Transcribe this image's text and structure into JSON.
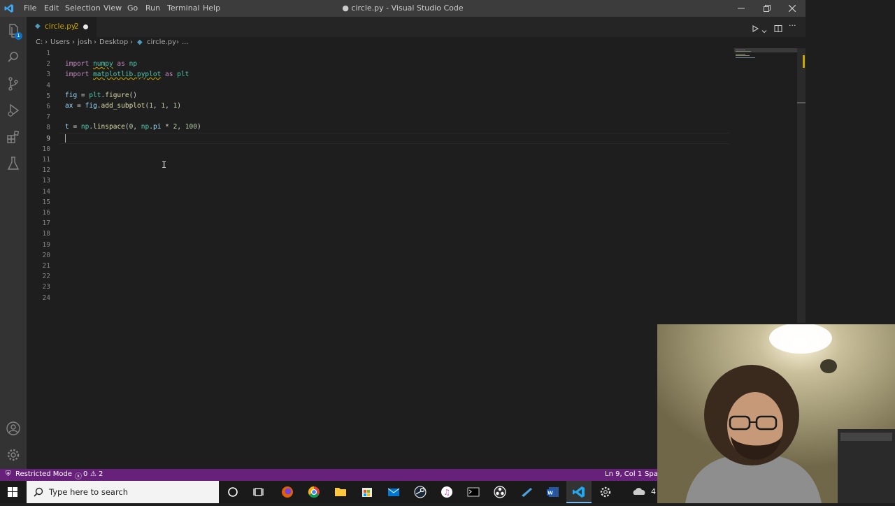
{
  "menu": [
    "File",
    "Edit",
    "Selection",
    "View",
    "Go",
    "Run",
    "Terminal",
    "Help"
  ],
  "window_title": "● circle.py - Visual Studio Code",
  "tab": {
    "filename": "circle.py",
    "problems": "2"
  },
  "breadcrumb": [
    "C:",
    "Users",
    "josh",
    "Desktop",
    "circle.py",
    "..."
  ],
  "activity_badge": "1",
  "code": {
    "line_numbers": [
      "1",
      "2",
      "3",
      "4",
      "5",
      "6",
      "7",
      "8",
      "9",
      "10",
      "11",
      "12",
      "13",
      "14",
      "15",
      "16",
      "17",
      "18",
      "19",
      "20",
      "21",
      "22",
      "23",
      "24"
    ],
    "l2": {
      "kw1": "import",
      "mod": "numpy",
      "kw2": "as",
      "alias": "np"
    },
    "l3": {
      "kw1": "import",
      "mod": "matplotlib.pyplot",
      "kw2": "as",
      "alias": "plt"
    },
    "l5": {
      "var": "fig",
      "eq": " = ",
      "obj": "plt",
      "dot": ".",
      "fn": "figure",
      "args": "()"
    },
    "l6": {
      "var": "ax",
      "eq": " = ",
      "obj": "fig",
      "dot": ".",
      "fn": "add_subplot",
      "open": "(",
      "a1": "1",
      ", ": ", ",
      "a2": "1",
      "sep2": ", ",
      "a3": "1",
      "close": ")"
    },
    "l8": {
      "var": "t",
      "eq": " = ",
      "obj": "np",
      "dot": ".",
      "fn": "linspace",
      "open": "(",
      "a1": "0",
      "sep1": ", ",
      "obj2": "np",
      "dot2": ".",
      "attr": "pi",
      "mul": " * ",
      "a2": "2",
      "sep2": ", ",
      "a3": "100",
      "close": ")"
    }
  },
  "status": {
    "mode": "Restricted Mode",
    "errors": "0",
    "warnings": "2",
    "position": "Ln 9, Col 1",
    "spaces": "Spac"
  },
  "taskbar": {
    "search_placeholder": "Type here to search",
    "tray_text": "4"
  },
  "colors": {
    "statusbar": "#68217a",
    "titlebar": "#3c3c3c",
    "activitybar": "#333333",
    "editor": "#1e1e1e"
  }
}
